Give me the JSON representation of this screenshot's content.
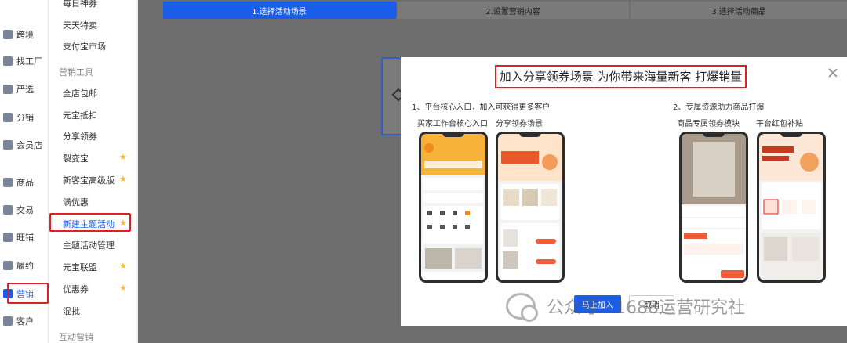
{
  "primary_nav": {
    "items": [
      {
        "label": "跨境",
        "icon": "globe-icon"
      },
      {
        "label": "找工厂",
        "icon": "factory-icon"
      },
      {
        "label": "严选",
        "icon": "factory-icon"
      },
      {
        "label": "分销",
        "icon": "share-icon"
      },
      {
        "label": "会员店",
        "icon": "diamond-icon"
      },
      {
        "label": "商品",
        "icon": "box-icon"
      },
      {
        "label": "交易",
        "icon": "order-icon"
      },
      {
        "label": "旺铺",
        "icon": "store-icon"
      },
      {
        "label": "履约",
        "icon": "truck-icon"
      },
      {
        "label": "营销",
        "icon": "marketing-icon"
      },
      {
        "label": "客户",
        "icon": "user-icon"
      }
    ],
    "active": "营销"
  },
  "secondary_nav": {
    "items": [
      {
        "label": "每日神券",
        "type": "item"
      },
      {
        "label": "天天特卖",
        "type": "item"
      },
      {
        "label": "支付宝市场",
        "type": "item"
      },
      {
        "label": "营销工具",
        "type": "group"
      },
      {
        "label": "全店包邮",
        "type": "item"
      },
      {
        "label": "元宝抵扣",
        "type": "item"
      },
      {
        "label": "分享领券",
        "type": "item"
      },
      {
        "label": "裂变宝",
        "type": "item",
        "star": true
      },
      {
        "label": "新客宝高级版",
        "type": "item",
        "star": true
      },
      {
        "label": "满优惠",
        "type": "item"
      },
      {
        "label": "新建主题活动",
        "type": "item",
        "star": true,
        "active": true
      },
      {
        "label": "主题活动管理",
        "type": "item"
      },
      {
        "label": "元宝联盟",
        "type": "item",
        "star": true
      },
      {
        "label": "优惠券",
        "type": "item",
        "star": true
      },
      {
        "label": "混批",
        "type": "item"
      },
      {
        "label": "互动营销",
        "type": "group"
      }
    ]
  },
  "steps": [
    "1.选择活动场景",
    "2.设置营销内容",
    "3.选择活动商品"
  ],
  "modal": {
    "title": "加入分享领券场景 为你带来海量新客 打爆销量",
    "section1": "1、平台核心入口，加入可获得更多客户",
    "section2": "2、专属资源助力商品打爆",
    "columns": [
      "买家工作台核心入口",
      "分享领券场景",
      "商品专属领券模块",
      "平台红包补贴"
    ],
    "primary_button": "马上加入",
    "secondary_button": "取消"
  },
  "watermark": "公众号 · 1688运营研究社",
  "colors": {
    "accent": "#1a5ee8",
    "highlight": "#e02020",
    "star": "#f5b82e"
  }
}
